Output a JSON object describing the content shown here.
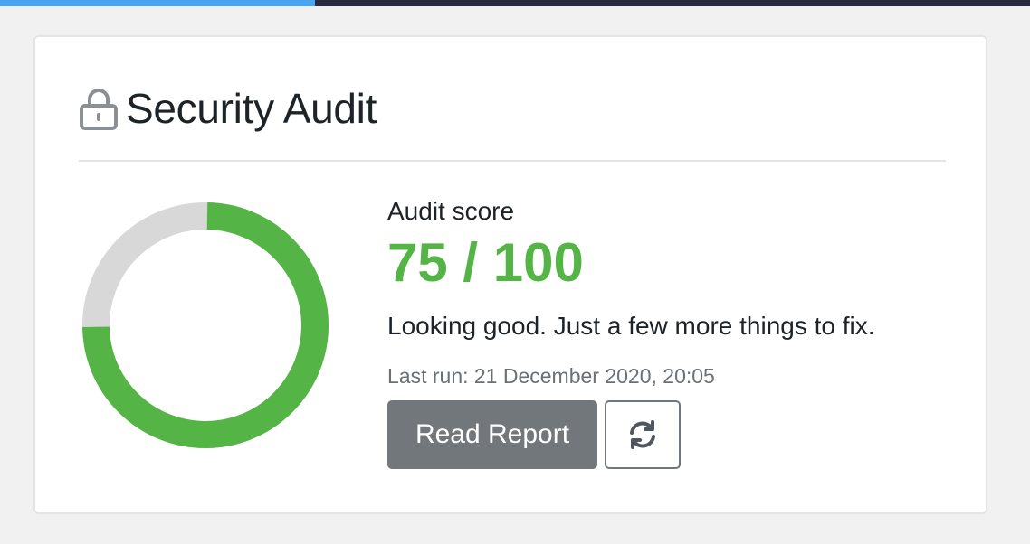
{
  "top_progress": {
    "value_fraction": 0.306,
    "fill_color": "#4ba6f2",
    "track_color": "#2b2a40"
  },
  "card": {
    "icon": "lock-icon",
    "title": "Security Audit"
  },
  "audit": {
    "label": "Audit score",
    "score": 75,
    "max": 100,
    "score_text": "75 / 100",
    "message": "Looking good. Just a few more things to fix.",
    "last_run": "Last run: 21 December 2020, 20:05",
    "score_color": "#54b546",
    "remainder_color": "#d8d8d8"
  },
  "actions": {
    "read_report_label": "Read Report",
    "refresh_icon": "refresh-icon"
  }
}
